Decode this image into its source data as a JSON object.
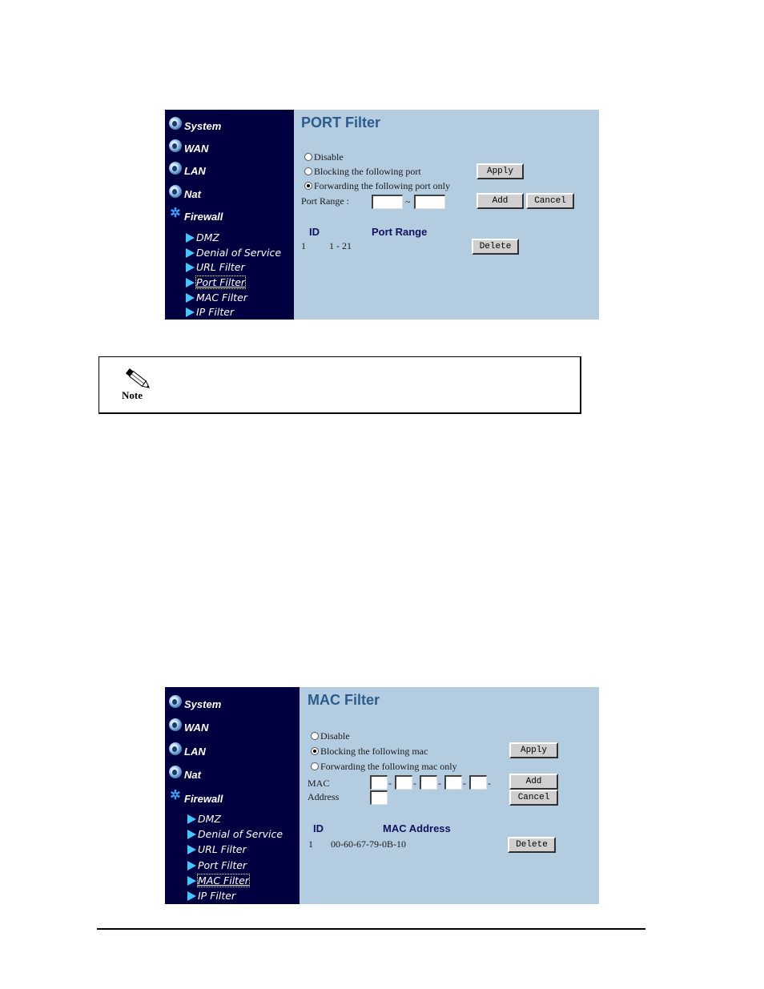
{
  "port_filter_screenshot": {
    "sidebar": {
      "top_items": [
        {
          "label": "System",
          "icon": "globe-icon"
        },
        {
          "label": "WAN",
          "icon": "globe-icon"
        },
        {
          "label": "LAN",
          "icon": "globe-icon"
        },
        {
          "label": "Nat",
          "icon": "globe-icon"
        },
        {
          "label": "Firewall",
          "icon": "spark-icon"
        }
      ],
      "sub_items": [
        {
          "label": "DMZ",
          "active": false
        },
        {
          "label": "Denial of Service",
          "active": false
        },
        {
          "label": "URL Filter",
          "active": false
        },
        {
          "label": "Port Filter",
          "active": true
        },
        {
          "label": "MAC Filter",
          "active": false
        },
        {
          "label": "IP Filter",
          "active": false
        }
      ]
    },
    "title": "PORT Filter",
    "options": [
      {
        "label": "Disable",
        "selected": false
      },
      {
        "label": "Blocking the following port",
        "selected": false
      },
      {
        "label": "Forwarding the following port only",
        "selected": true
      }
    ],
    "port_range_label": "Port Range :",
    "range_separator": "~",
    "port_from_value": "",
    "port_to_value": "",
    "apply_label": "Apply",
    "add_label": "Add",
    "cancel_label": "Cancel",
    "table": {
      "headers": [
        "ID",
        "Port Range"
      ],
      "rows": [
        {
          "id": "1",
          "value": "1 - 21",
          "delete_label": "Delete"
        }
      ]
    }
  },
  "note": {
    "label": "Note",
    "icon": "pencil-icon",
    "text": ""
  },
  "mac_filter_screenshot": {
    "sidebar": {
      "top_items": [
        {
          "label": "System",
          "icon": "globe-icon"
        },
        {
          "label": "WAN",
          "icon": "globe-icon"
        },
        {
          "label": "LAN",
          "icon": "globe-icon"
        },
        {
          "label": "Nat",
          "icon": "globe-icon"
        },
        {
          "label": "Firewall",
          "icon": "spark-icon"
        }
      ],
      "sub_items": [
        {
          "label": "DMZ",
          "active": false
        },
        {
          "label": "Denial of Service",
          "active": false
        },
        {
          "label": "URL Filter",
          "active": false
        },
        {
          "label": "Port Filter",
          "active": false
        },
        {
          "label": "MAC Filter",
          "active": true
        },
        {
          "label": "IP Filter",
          "active": false
        }
      ]
    },
    "title": "MAC Filter",
    "options": [
      {
        "label": "Disable",
        "selected": false
      },
      {
        "label": "Blocking the following mac",
        "selected": true
      },
      {
        "label": "Forwarding the following mac only",
        "selected": false
      }
    ],
    "mac_label_line1": "MAC",
    "mac_label_line2": "Address",
    "mac_separator": "-",
    "mac_octets": [
      "",
      "",
      "",
      "",
      "",
      ""
    ],
    "apply_label": "Apply",
    "add_label": "Add",
    "cancel_label": "Cancel",
    "table": {
      "headers": [
        "ID",
        "MAC Address"
      ],
      "rows": [
        {
          "id": "1",
          "value": "00-60-67-79-0B-10",
          "delete_label": "Delete"
        }
      ]
    }
  }
}
